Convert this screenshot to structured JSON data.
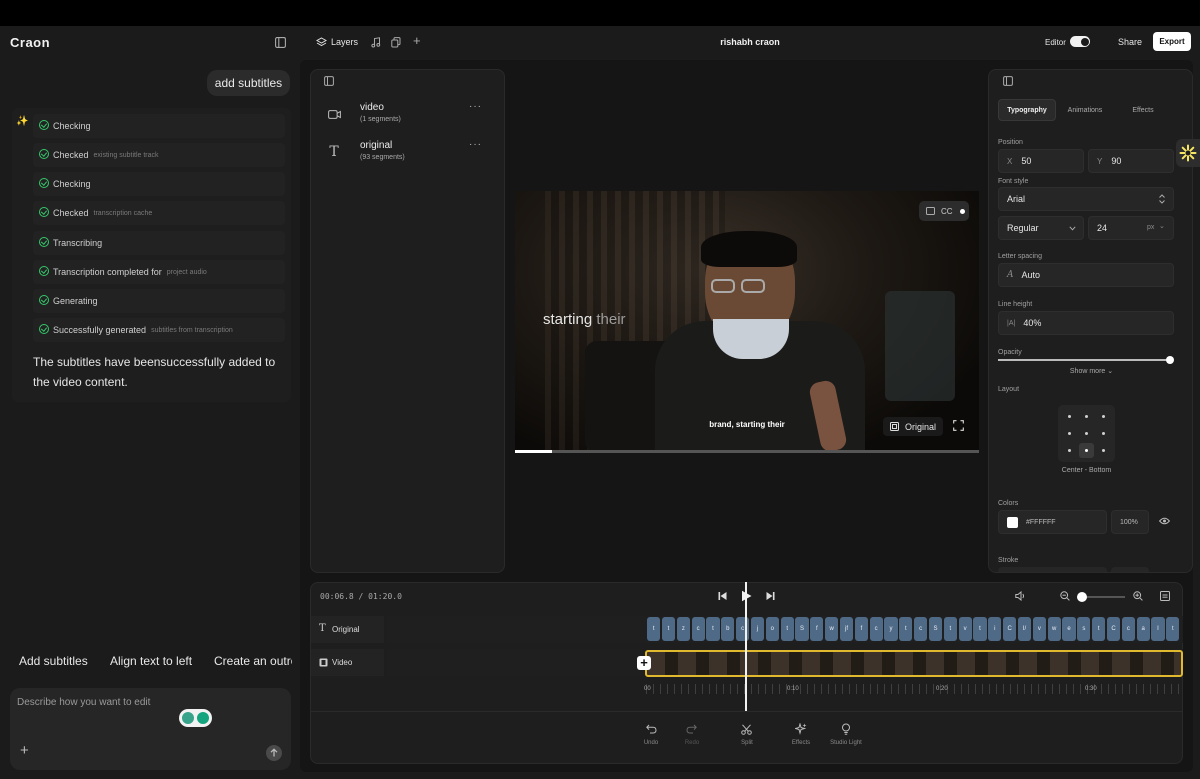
{
  "app": {
    "logo": "Craon",
    "project_title": "rishabh craon",
    "editor_label": "Editor",
    "share_label": "Share",
    "export_label": "Export",
    "layers_label": "Layers"
  },
  "chat": {
    "user_message": "add subtitles",
    "steps": [
      {
        "label": "Checking",
        "detail": ""
      },
      {
        "label": "Checked",
        "detail": "existing subtitle track"
      },
      {
        "label": "Checking",
        "detail": ""
      },
      {
        "label": "Checked",
        "detail": "transcription cache"
      },
      {
        "label": "Transcribing",
        "detail": ""
      },
      {
        "label": "Transcription completed for",
        "detail": "project audio"
      },
      {
        "label": "Generating",
        "detail": ""
      },
      {
        "label": "Successfully generated",
        "detail": "subtitles from transcription"
      }
    ],
    "result_text": "The subtitles have beensuccessfully added to the video content.",
    "suggestions": [
      "Add subtitles",
      "Align text to left",
      "Create an outro"
    ],
    "input_placeholder": "Describe how you want to edit"
  },
  "layers": [
    {
      "name": "video",
      "meta": "(1 segments)",
      "icon": "video-camera-icon"
    },
    {
      "name": "original",
      "meta": "(93 segments)",
      "icon": "text-icon"
    }
  ],
  "preview": {
    "overlay_text_white": "starting",
    "overlay_text_grey": "their",
    "caption": "brand, starting their",
    "cc_label": "CC",
    "original_label": "Original",
    "progress": 0.08
  },
  "inspector": {
    "tabs": [
      "Typography",
      "Animations",
      "Effects"
    ],
    "position_label": "Position",
    "x_label": "X",
    "x_value": "50",
    "y_label": "Y",
    "y_value": "90",
    "font_style_label": "Font style",
    "font_family": "Arial",
    "font_weight": "Regular",
    "font_size": "24",
    "font_size_unit": "px",
    "letter_spacing_label": "Letter spacing",
    "letter_spacing_value": "Auto",
    "line_height_label": "Line height",
    "line_height_value": "40%",
    "opacity_label": "Opacity",
    "opacity": 1.0,
    "show_more": "Show more",
    "layout_label": "Layout",
    "layout_value": "Center - Bottom",
    "colors_label": "Colors",
    "color_hex": "#FFFFFF",
    "color_opacity": "100%",
    "stroke_label": "Stroke"
  },
  "timeline": {
    "current_time": "00:06.8",
    "total_time": "01:20.0",
    "tracks": [
      {
        "name": "Original",
        "icon": "text-icon"
      },
      {
        "name": "Video",
        "icon": "film-icon"
      }
    ],
    "ruler": [
      "00",
      "0:10",
      "0:20",
      "0:30"
    ],
    "clips": [
      "t",
      "t",
      "z",
      "c",
      "t",
      "b",
      "c",
      "j",
      "o",
      "t",
      "S",
      "f",
      "w",
      "jf",
      "f",
      "c",
      "y",
      "t",
      "c",
      "S",
      "t",
      "v",
      "t",
      "i",
      "C",
      "I/",
      "v",
      "w",
      "e",
      "s",
      "t",
      "C",
      "c",
      "a",
      "I",
      "t"
    ],
    "tools": [
      "Undo",
      "Redo",
      "Split",
      "Effects",
      "Studio Light"
    ]
  },
  "colors": {
    "accent_green": "#35c96b",
    "clip_blue": "#4f6a86",
    "video_track_border": "#e0b92f"
  }
}
